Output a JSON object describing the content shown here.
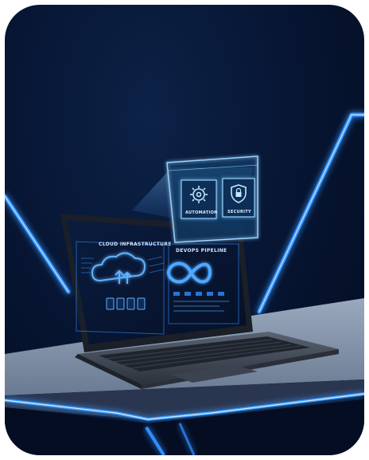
{
  "scene": {
    "screen": {
      "left_panel_title": "CLOUD INFRASTRUCTURE",
      "right_panel_title": "DEVOPS PIPELINE"
    },
    "holo_panel": {
      "tiles": [
        {
          "label": "AUTOMATION",
          "icon": "gear-icon"
        },
        {
          "label": "SECURITY",
          "icon": "shield-lock-icon"
        }
      ]
    },
    "colors": {
      "neon": "#2f8dff",
      "neon_glow": "#58a8ff",
      "background": "#06132e",
      "desk": "#8fa0b6",
      "laptop": "#4a5260"
    }
  }
}
